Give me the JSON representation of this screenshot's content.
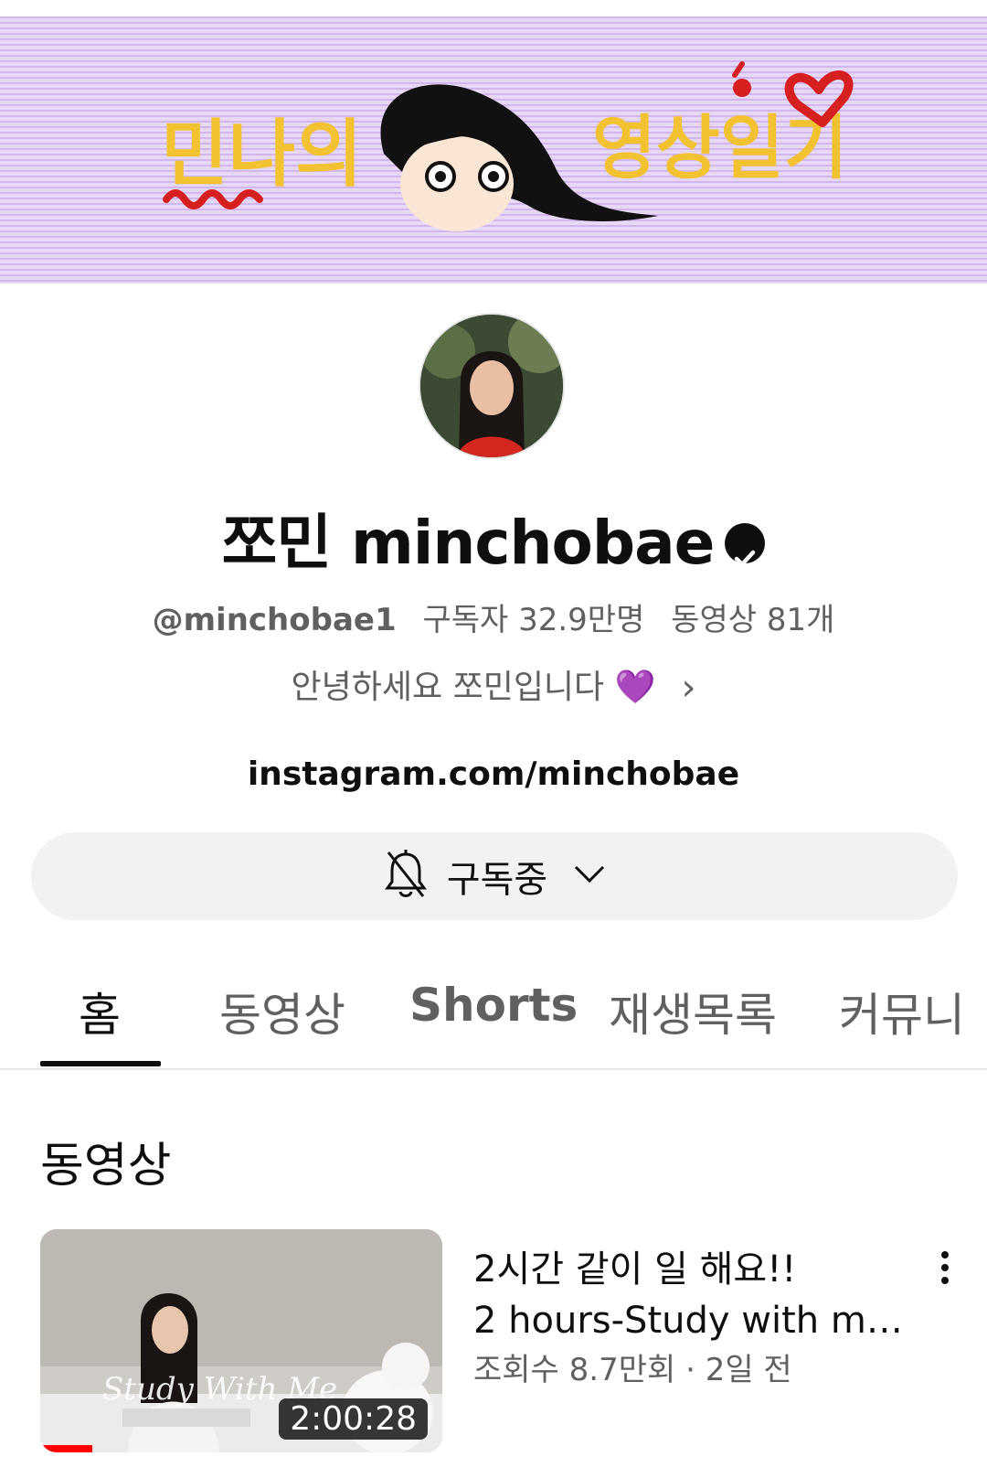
{
  "banner": {
    "left_text": "민나의",
    "right_text": "영상일기"
  },
  "channel": {
    "name": "쪼민 minchobae",
    "handle": "@minchobae1",
    "subscribers": "구독자 32.9만명",
    "video_count": "동영상 81개",
    "description": "안녕하세요 쪼민입니다 💜",
    "link": "instagram.com/minchobae"
  },
  "subscribe": {
    "label": "구독중"
  },
  "tabs": [
    {
      "label": "홈"
    },
    {
      "label": "동영상"
    },
    {
      "label": "Shorts"
    },
    {
      "label": "재생목록"
    },
    {
      "label": "커뮤니"
    }
  ],
  "section": {
    "title": "동영상"
  },
  "video": {
    "title_line1": "2시간 같이 일 해요!!",
    "title_line2": "2 hours-Study with me!…",
    "meta": "조회수 8.7만회 · 2일 전",
    "duration": "2:00:28",
    "thumb_overlay": "Study With Me",
    "watched_fraction": 0.13
  },
  "colors": {
    "banner_bg": "#dcc4f0",
    "accent_yellow": "#f2c230",
    "accent_red": "#d62020",
    "progress_red": "#ff0000"
  }
}
